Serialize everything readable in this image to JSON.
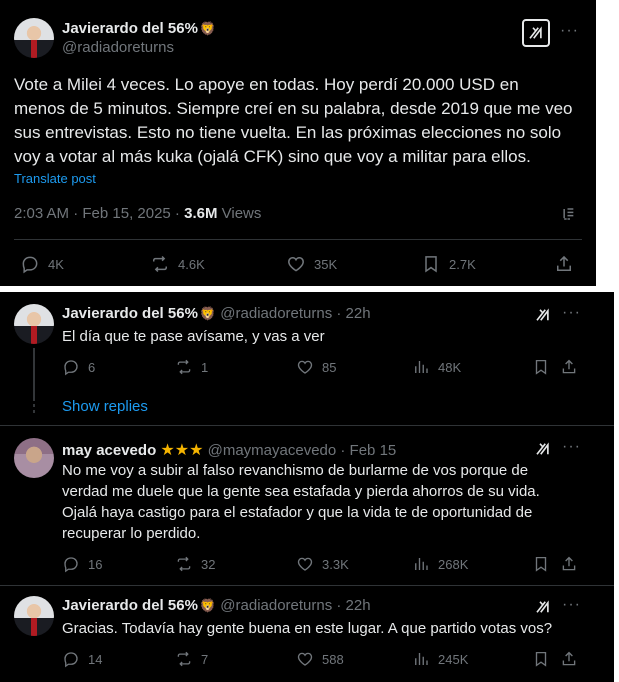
{
  "main_post": {
    "display_name": "Javierardo del 56%",
    "emoji": "🦁",
    "handle": "@radiadoreturns",
    "text_lines": [
      "Vote a Milei 4 veces. Lo apoye en todas. Hoy perdí 20.000 USD en",
      "menos de 5 minutos. Siempre creí en su palabra, desde 2019 que me veo",
      "sus entrevistas. Esto no tiene vuelta. En las próximas elecciones no solo",
      "voy a votar al más kuka (ojalá CFK) sino que voy a militar para ellos."
    ],
    "translate_label": "Translate post",
    "timestamp": "2:03 AM · Feb 15, 2025 · ",
    "views_count": "3.6M",
    "views_label": "Views",
    "replies": "4K",
    "reposts": "4.6K",
    "likes": "35K",
    "bookmarks": "2.7K"
  },
  "replies": [
    {
      "display_name": "Javierardo del 56%",
      "emoji": "🦁",
      "handle": "@radiadoreturns · 22h",
      "text_lines": [
        "El día que te pase avísame, y vas a ver"
      ],
      "replies": "6",
      "reposts": "1",
      "likes": "85",
      "views": "48K"
    },
    {
      "display_name": "may acevedo",
      "stars": "★★★",
      "handle": "@maymayacevedo · Feb 15",
      "text_lines": [
        "No me voy a subir al falso revanchismo de burlarme de vos porque de",
        "verdad me duele que la gente sea estafada y pierda ahorros de su vida.",
        "Ojalá haya castigo para el estafador y que la vida te de oportunidad de",
        "recuperar lo perdido."
      ],
      "replies": "16",
      "reposts": "32",
      "likes": "3.3K",
      "views": "268K"
    },
    {
      "display_name": "Javierardo del 56%",
      "emoji": "🦁",
      "handle": "@radiadoreturns · 22h",
      "text_lines": [
        "Gracias. Todavía hay gente buena en este lugar. A que partido votas vos?"
      ],
      "replies": "14",
      "reposts": "7",
      "likes": "588",
      "views": "245K"
    }
  ],
  "show_replies_label": "Show replies",
  "more_label": "···",
  "icons": {
    "reply": "reply-icon",
    "repost": "repost-icon",
    "like": "heart-icon",
    "views": "analytics-icon",
    "bookmark": "bookmark-icon",
    "share": "share-icon",
    "grok": "grok-icon",
    "more": "more-icon"
  },
  "colors": {
    "background": "#000000",
    "text": "#e7e9ea",
    "muted": "#71767b",
    "link": "#1d9bf0",
    "divider": "#2f3336"
  }
}
